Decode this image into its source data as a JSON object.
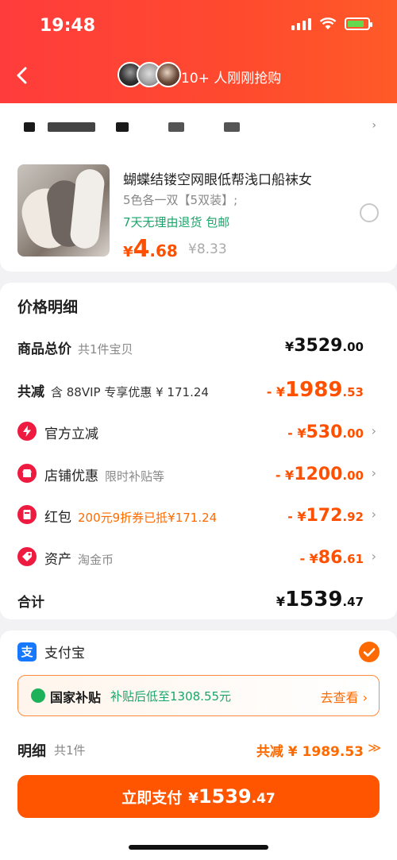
{
  "status_bar": {
    "time": "19:48"
  },
  "header": {
    "buyers_text": "10+ 人刚刚抢购"
  },
  "product": {
    "title": "蝴蝶结镂空网眼低帮浅口船袜女",
    "spec": "5色各一双【5双装】;",
    "tags": "7天无理由退货 包邮",
    "price_currency": "¥",
    "price_int": "4",
    "price_dec": ".68",
    "original_price": "¥8.33"
  },
  "price_detail": {
    "title": "价格明细",
    "total": {
      "label": "商品总价",
      "sub": "共1件宝贝",
      "c": "¥",
      "i": "3529",
      "d": ".00"
    },
    "reduction": {
      "label": "共减",
      "sub": "含 88VIP 专享优惠 ¥ 171.24",
      "c": "- ¥",
      "i": "1989",
      "d": ".53"
    },
    "official": {
      "label": "官方立减",
      "c": "- ¥",
      "i": "530",
      "d": ".00"
    },
    "store": {
      "label": "店铺优惠",
      "sub": "限时补贴等",
      "c": "- ¥",
      "i": "1200",
      "d": ".00"
    },
    "redpacket": {
      "label": "红包",
      "sub": "200元9折券已抵¥171.24",
      "c": "- ¥",
      "i": "172",
      "d": ".92"
    },
    "assets": {
      "label": "资产",
      "sub": "淘金币",
      "c": "- ¥",
      "i": "86",
      "d": ".61"
    },
    "sum": {
      "label": "合计",
      "c": "¥",
      "i": "1539",
      "d": ".47"
    }
  },
  "payment": {
    "method_icon": "支",
    "method_label": "支付宝",
    "subsidy_name": "国家补贴",
    "subsidy_desc": "补贴后低至1308.55元",
    "subsidy_link": "去查看 ›"
  },
  "detail_row": {
    "label": "明细",
    "count": "共1件",
    "total": "共减 ¥ 1989.53",
    "toggle": "≫"
  },
  "pay_button": {
    "label": "立即支付",
    "c": "¥",
    "i": "1539",
    "d": ".47"
  },
  "colors": {
    "accent": "#ff5000",
    "header_red": "#ff3c3c",
    "green": "#1aa56a",
    "alipay_blue": "#1677ff"
  }
}
